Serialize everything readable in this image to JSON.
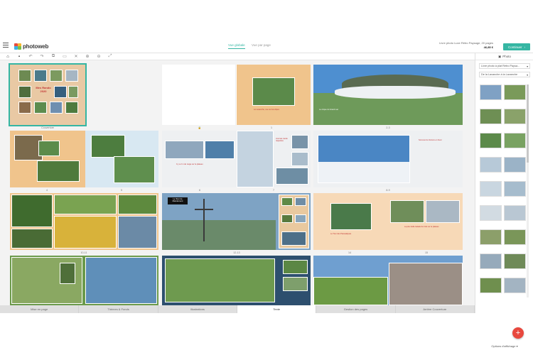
{
  "brand": {
    "name": "photoweb"
  },
  "header": {
    "view_tabs": [
      {
        "label": "Vue globale",
        "active": true
      },
      {
        "label": "Vue par page",
        "active": false
      }
    ],
    "product_line": "Livre photo Luxe Rétro Paysage, 20 pages",
    "price": "46,85 €",
    "continue_label": "Continuer"
  },
  "canvas": {
    "captions": [
      "Couverture",
      "1",
      "2-3",
      "4",
      "5",
      "6",
      "7",
      "8-9",
      "10-11",
      "12-13",
      "14",
      "15"
    ],
    "texts": {
      "cover_title": "Mes Rando 2020",
      "p1_line1": "Le Lavanche, vue sur les Alpes",
      "p2_line1": "Le cirque du Grand Lac",
      "p6_text": "Il y a 2 m de neige sur le plateau",
      "p7_text": "Journée rando raquettes",
      "p9_text": "Sommet du Vercors en hiver",
      "p12_label": "Le Tour de Mandement",
      "p14_label": "Le Tour des Paravaliques",
      "p15_text": "La plus belle balade de l'été sur le plateau"
    }
  },
  "bottom_tabs": [
    "Mise en page",
    "Thèmes & Fonds",
    "Illustrations",
    "Texte",
    "Gestion des pages",
    "Arrière Couverture"
  ],
  "active_bottom_tab": "Texte",
  "panel": {
    "tab_label": "Photo",
    "select1": "Livre photo à plat Rétro Paysa...",
    "select2": "De la Lavanche à la Lavanche",
    "options_label": "Options d'affichage"
  },
  "colors": {
    "accent": "#35b6a3",
    "fab": "#e8483e"
  }
}
